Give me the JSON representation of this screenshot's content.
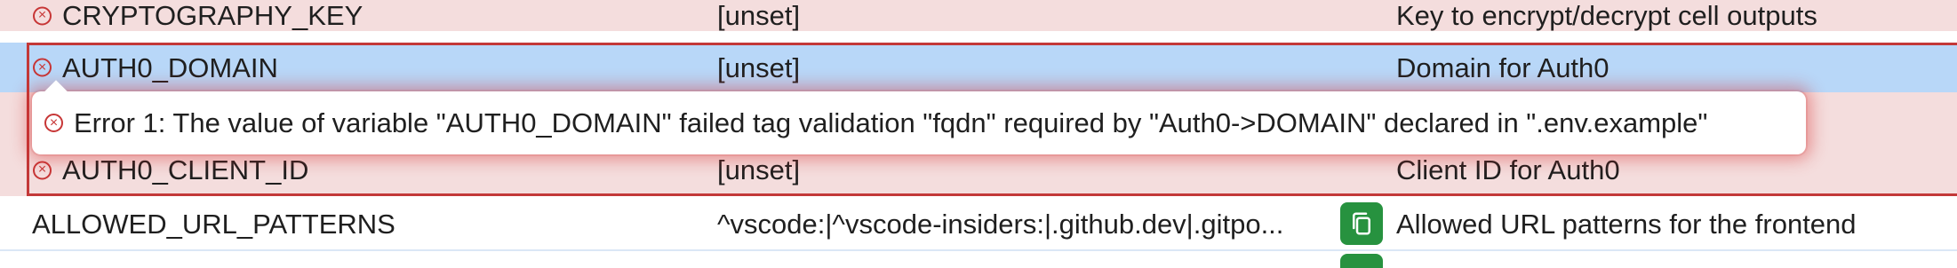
{
  "rows": [
    {
      "name": "CRYPTOGRAPHY_KEY",
      "value": "[unset]",
      "description": "Key to encrypt/decrypt cell outputs",
      "status": "error"
    },
    {
      "name": "AUTH0_DOMAIN",
      "value": "[unset]",
      "description": "Domain for Auth0",
      "status": "error",
      "selected": true
    },
    {
      "name": "AUTH0_CLIENT_ID",
      "value": "[unset]",
      "description": "Client ID for Auth0",
      "status": "error"
    },
    {
      "name": "ALLOWED_URL_PATTERNS",
      "value": "^vscode:|^vscode-insiders:|.github.dev|.gitpo...",
      "description": "Allowed URL patterns for the frontend",
      "status": "ok"
    }
  ],
  "tooltip": {
    "message": "Error 1: The value of variable \"AUTH0_DOMAIN\" failed tag validation \"fqdn\" required by \"Auth0->DOMAIN\" declared in \".env.example\""
  },
  "icons": {
    "error": "error-circle-x-icon",
    "copy": "copy-icon"
  },
  "colors": {
    "error_row_bg": "#f4dddd",
    "selected_row_bg": "#b8d7f8",
    "error_border": "#c33838",
    "copy_button_bg": "#27923f"
  }
}
